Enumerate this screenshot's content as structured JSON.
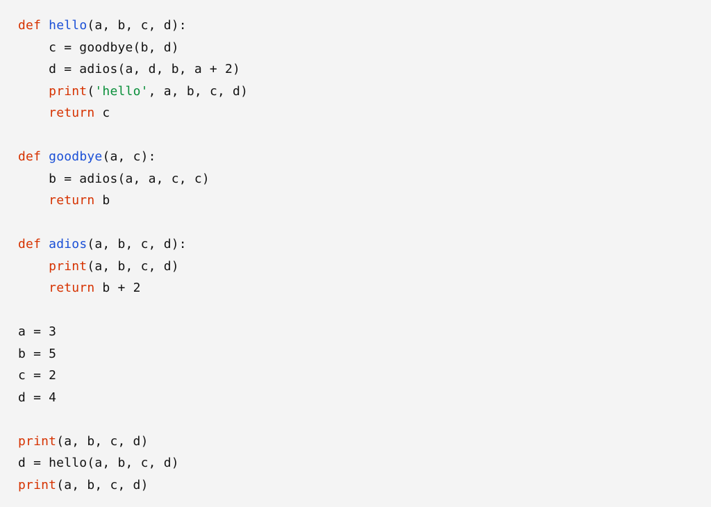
{
  "code": {
    "tokens": [
      {
        "cls": "kw",
        "t": "def"
      },
      {
        "t": " "
      },
      {
        "cls": "fn",
        "t": "hello"
      },
      {
        "t": "(a, b, c, d):"
      },
      {
        "nl": true
      },
      {
        "t": "    c = goodbye(b, d)"
      },
      {
        "nl": true
      },
      {
        "t": "    d = adios(a, d, b, a + "
      },
      {
        "cls": "num",
        "t": "2"
      },
      {
        "t": ")"
      },
      {
        "nl": true
      },
      {
        "t": "    "
      },
      {
        "cls": "call",
        "t": "print"
      },
      {
        "t": "("
      },
      {
        "cls": "str",
        "t": "'hello'"
      },
      {
        "t": ", a, b, c, d)"
      },
      {
        "nl": true
      },
      {
        "t": "    "
      },
      {
        "cls": "kw",
        "t": "return"
      },
      {
        "t": " c"
      },
      {
        "nl": true
      },
      {
        "nl": true
      },
      {
        "cls": "kw",
        "t": "def"
      },
      {
        "t": " "
      },
      {
        "cls": "fn",
        "t": "goodbye"
      },
      {
        "t": "(a, c):"
      },
      {
        "nl": true
      },
      {
        "t": "    b = adios(a, a, c, c)"
      },
      {
        "nl": true
      },
      {
        "t": "    "
      },
      {
        "cls": "kw",
        "t": "return"
      },
      {
        "t": " b"
      },
      {
        "nl": true
      },
      {
        "nl": true
      },
      {
        "cls": "kw",
        "t": "def"
      },
      {
        "t": " "
      },
      {
        "cls": "fn",
        "t": "adios"
      },
      {
        "t": "(a, b, c, d):"
      },
      {
        "nl": true
      },
      {
        "t": "    "
      },
      {
        "cls": "call",
        "t": "print"
      },
      {
        "t": "(a, b, c, d)"
      },
      {
        "nl": true
      },
      {
        "t": "    "
      },
      {
        "cls": "kw",
        "t": "return"
      },
      {
        "t": " b + "
      },
      {
        "cls": "num",
        "t": "2"
      },
      {
        "nl": true
      },
      {
        "nl": true
      },
      {
        "t": "a = "
      },
      {
        "cls": "num",
        "t": "3"
      },
      {
        "nl": true
      },
      {
        "t": "b = "
      },
      {
        "cls": "num",
        "t": "5"
      },
      {
        "nl": true
      },
      {
        "t": "c = "
      },
      {
        "cls": "num",
        "t": "2"
      },
      {
        "nl": true
      },
      {
        "t": "d = "
      },
      {
        "cls": "num",
        "t": "4"
      },
      {
        "nl": true
      },
      {
        "nl": true
      },
      {
        "cls": "call",
        "t": "print"
      },
      {
        "t": "(a, b, c, d)"
      },
      {
        "nl": true
      },
      {
        "t": "d = hello(a, b, c, d)"
      },
      {
        "nl": true
      },
      {
        "cls": "call",
        "t": "print"
      },
      {
        "t": "(a, b, c, d)"
      }
    ]
  }
}
